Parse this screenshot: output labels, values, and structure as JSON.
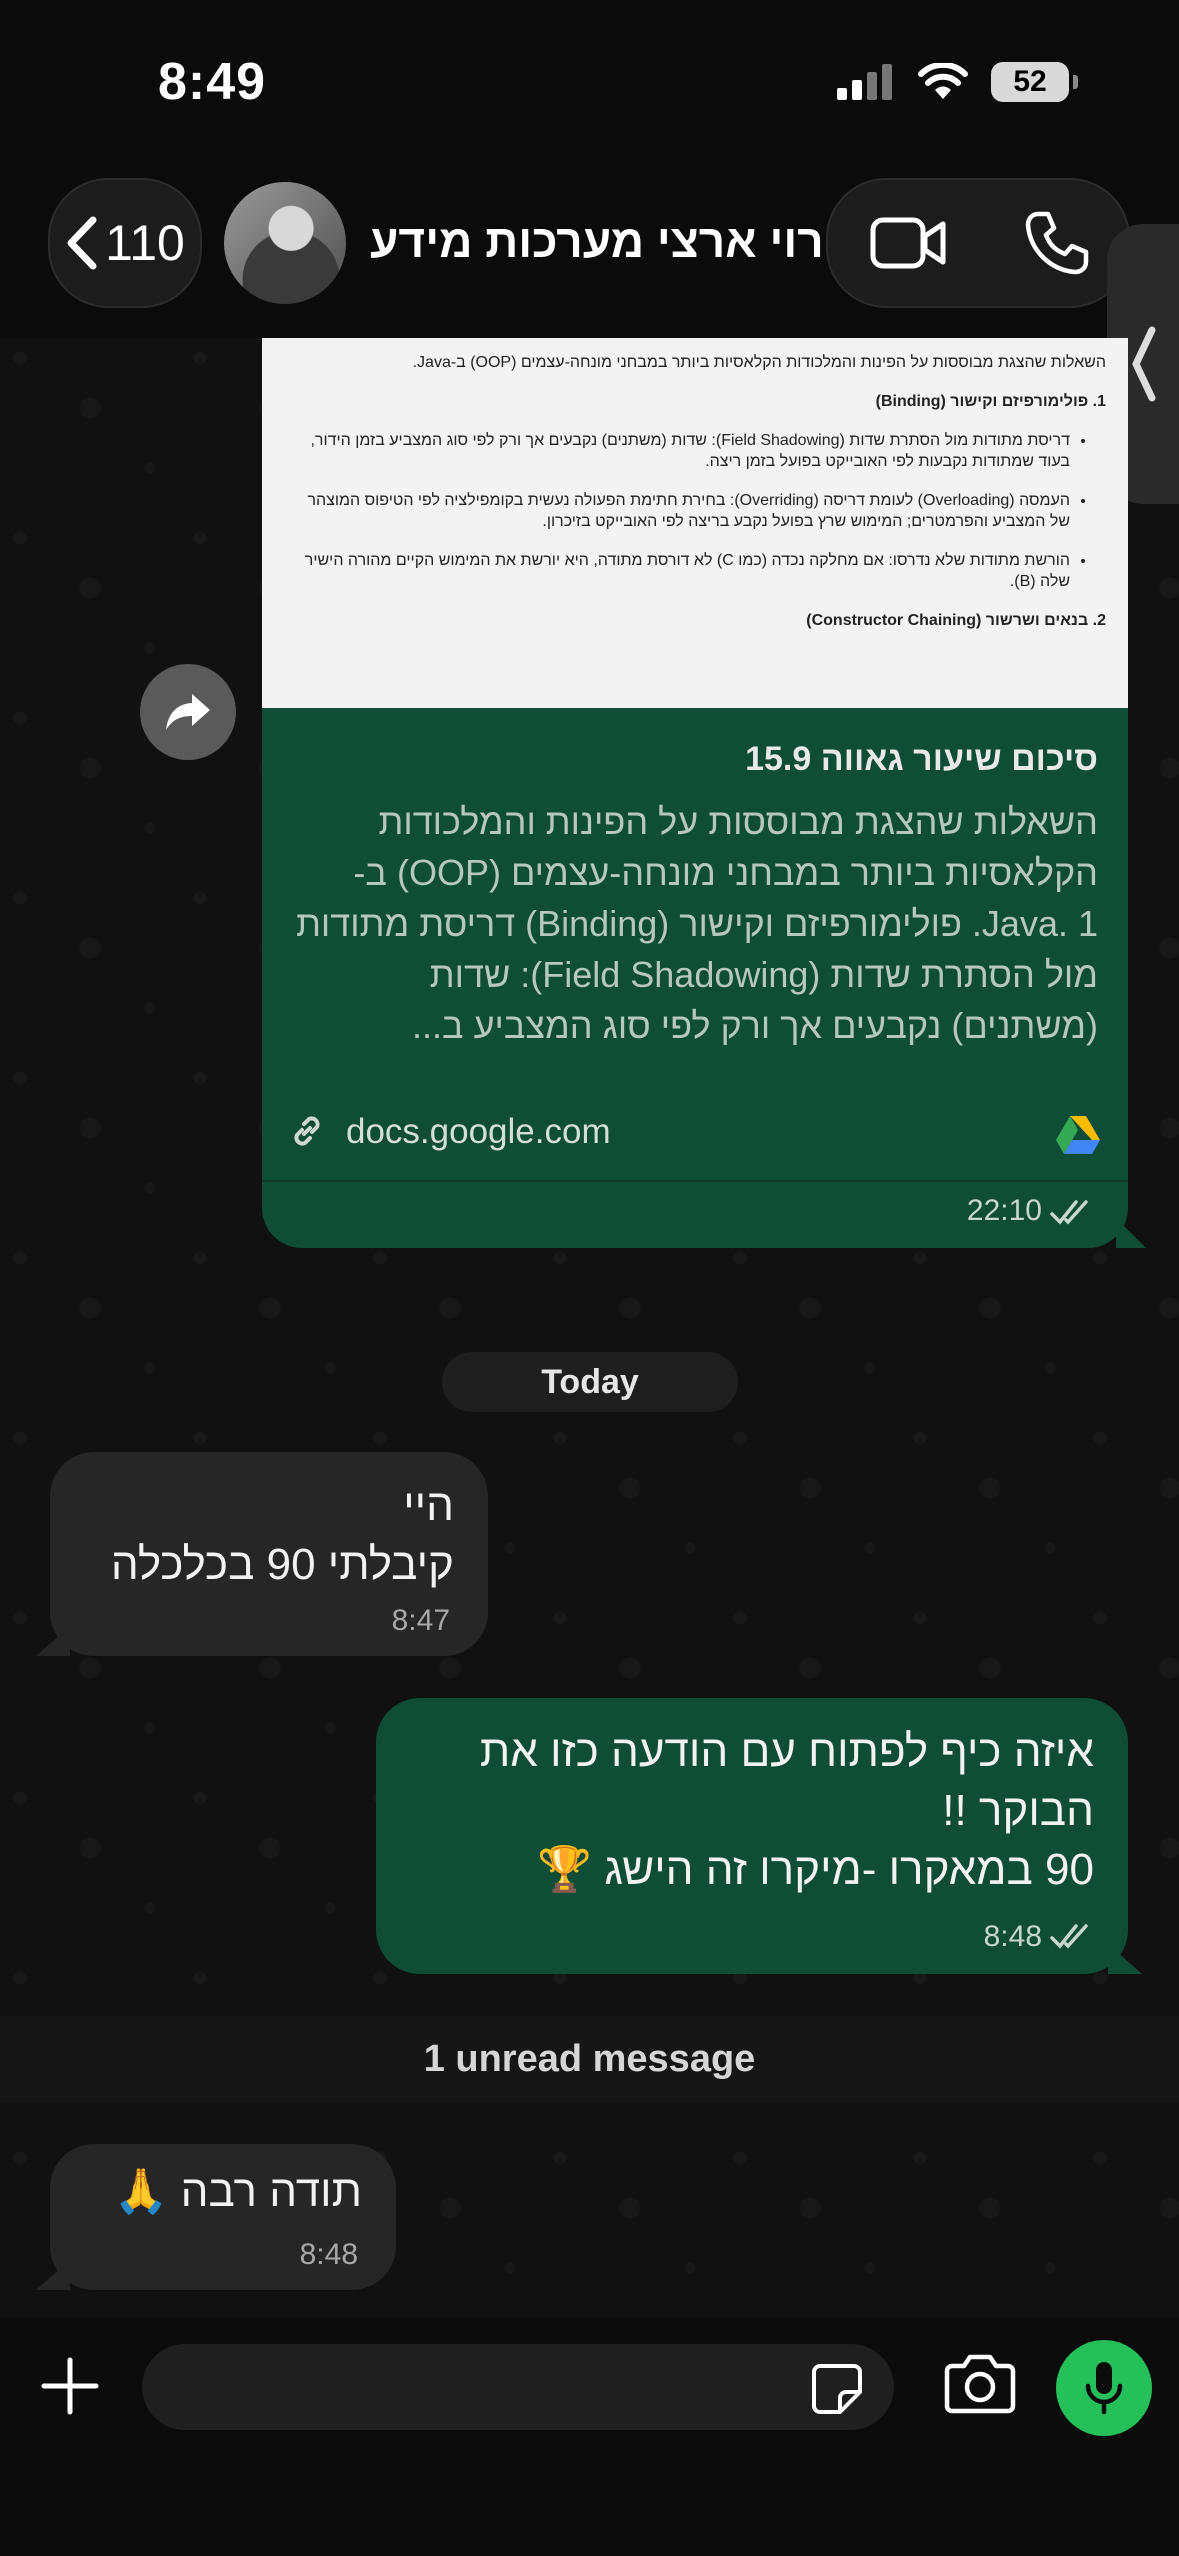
{
  "status_bar": {
    "time": "8:49",
    "battery": "52"
  },
  "header": {
    "back_count": "110",
    "contact_name": "רוי ארצי מערכות מידע"
  },
  "link_message": {
    "doc_preview": {
      "intro": "השאלות שהצגת מבוססות על הפינות והמלכודות הקלאסיות ביותר במבחני מונחה-עצמים (OOP) ב-Java.",
      "section1": "1. פולימורפיזם וקישור (Binding)",
      "bullets": [
        "דריסת מתודות מול הסתרת שדות (Field Shadowing): שדות (משתנים) נקבעים אך ורק לפי סוג המצביע בזמן הידור, בעוד שמתודות נקבעות לפי האובייקט בפועל בזמן ריצה.",
        "העמסה (Overloading) לעומת דריסה (Overriding): בחירת חתימת הפעולה נעשית בקומפילציה לפי הטיפוס המוצהר של המצביע והפרמטרים; המימוש שרץ בפועל נקבע בריצה לפי האובייקט בזיכרון.",
        "הורשת מתודות שלא נדרסו: אם מחלקה נכדה (כמו C) לא דורסת מתודה, היא יורשת את המימוש הקיים מהורה הישיר שלה (B)."
      ],
      "section2": "2. בנאים ושרשור (Constructor Chaining)"
    },
    "title": "סיכום שיעור גאווה 15.9",
    "description": "השאלות שהצגת מבוססות על הפינות והמלכודות הקלאסיות ביותר במבחני מונחה-עצמים (OOP) ב-Java. 1. פולימורפיזם וקישור (Binding)  דריסת מתודות מול הסתרת שדות (Field Shadowing): שדות (משתנים) נקבעים אך ורק לפי סוג המצביע ב...",
    "url": "docs.google.com",
    "time": "22:10"
  },
  "date_divider": "Today",
  "messages": [
    {
      "id": "in1",
      "lines": [
        "היי",
        "קיבלתי 90 בכלכלה"
      ],
      "time": "8:47"
    },
    {
      "id": "out1",
      "lines": [
        "איזה כיף לפתוח עם הודעה כזו את",
        "הבוקר !!",
        "90 במאקרו -מיקרו זה הישג 🏆"
      ],
      "time": "8:48"
    },
    {
      "id": "in2",
      "lines": [
        "תודה רבה 🙏"
      ],
      "time": "8:48"
    }
  ],
  "unread_divider": "1 unread message",
  "colors": {
    "outgoing": "#0f4d37",
    "incoming": "#262626",
    "mic": "#25c05a"
  },
  "icons": [
    "back-chevron-icon",
    "video-call-icon",
    "phone-icon",
    "forward-icon",
    "link-icon",
    "google-drive-icon",
    "double-check-icon",
    "plus-icon",
    "sticker-icon",
    "camera-icon",
    "microphone-icon"
  ]
}
